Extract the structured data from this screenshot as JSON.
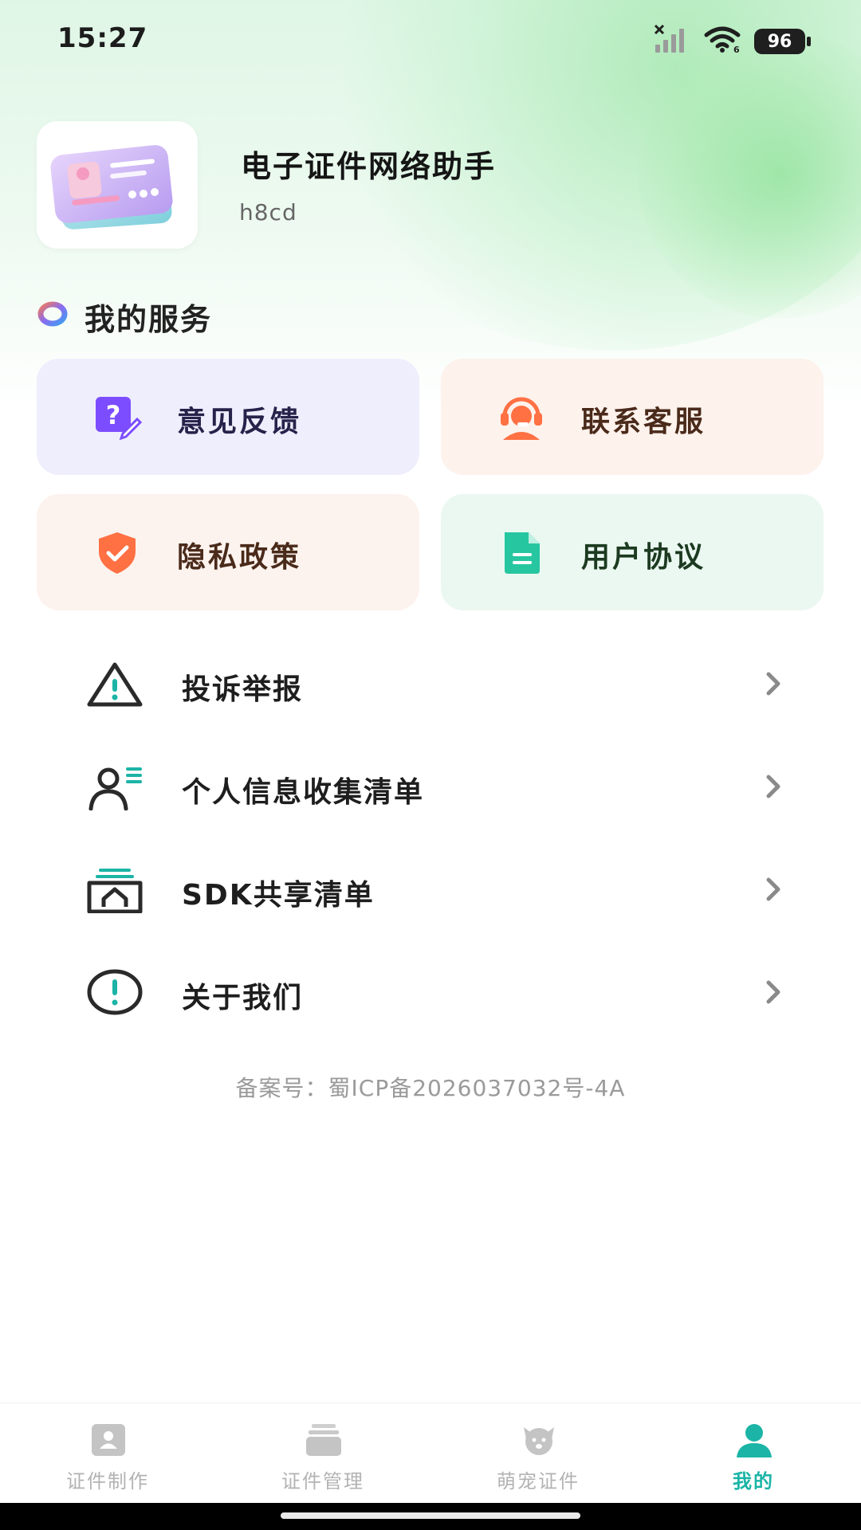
{
  "status_bar": {
    "time": "15:27",
    "battery": "96",
    "icons": [
      "signal-off-icon",
      "wifi-icon",
      "battery-icon"
    ]
  },
  "profile": {
    "app_name": "电子证件网络助手",
    "user_id": "h8cd",
    "avatar_icon": "id-card-icon"
  },
  "services": {
    "title": "我的服务",
    "cards": [
      {
        "label": "意见反馈",
        "icon": "feedback-icon",
        "color": "#7c4dff"
      },
      {
        "label": "联系客服",
        "icon": "customer-service-icon",
        "color": "#ff7043"
      },
      {
        "label": "隐私政策",
        "icon": "privacy-shield-icon",
        "color": "#ff7043"
      },
      {
        "label": "用户协议",
        "icon": "document-icon",
        "color": "#26c6a0"
      }
    ]
  },
  "menu": {
    "items": [
      {
        "label": "投诉举报",
        "icon": "warning-icon"
      },
      {
        "label": "个人信息收集清单",
        "icon": "personal-info-icon"
      },
      {
        "label": "SDK共享清单",
        "icon": "sdk-share-icon"
      },
      {
        "label": "关于我们",
        "icon": "info-icon"
      }
    ]
  },
  "footer": {
    "icp": "备案号：蜀ICP备2026037032号-4A"
  },
  "bottom_nav": {
    "items": [
      {
        "label": "证件制作",
        "icon": "id-photo-icon",
        "active": false
      },
      {
        "label": "证件管理",
        "icon": "folder-stack-icon",
        "active": false
      },
      {
        "label": "萌宠证件",
        "icon": "pet-icon",
        "active": false
      },
      {
        "label": "我的",
        "icon": "profile-icon",
        "active": true
      }
    ],
    "active_color": "#1bb4a6",
    "inactive_color": "#b3b3b3"
  }
}
